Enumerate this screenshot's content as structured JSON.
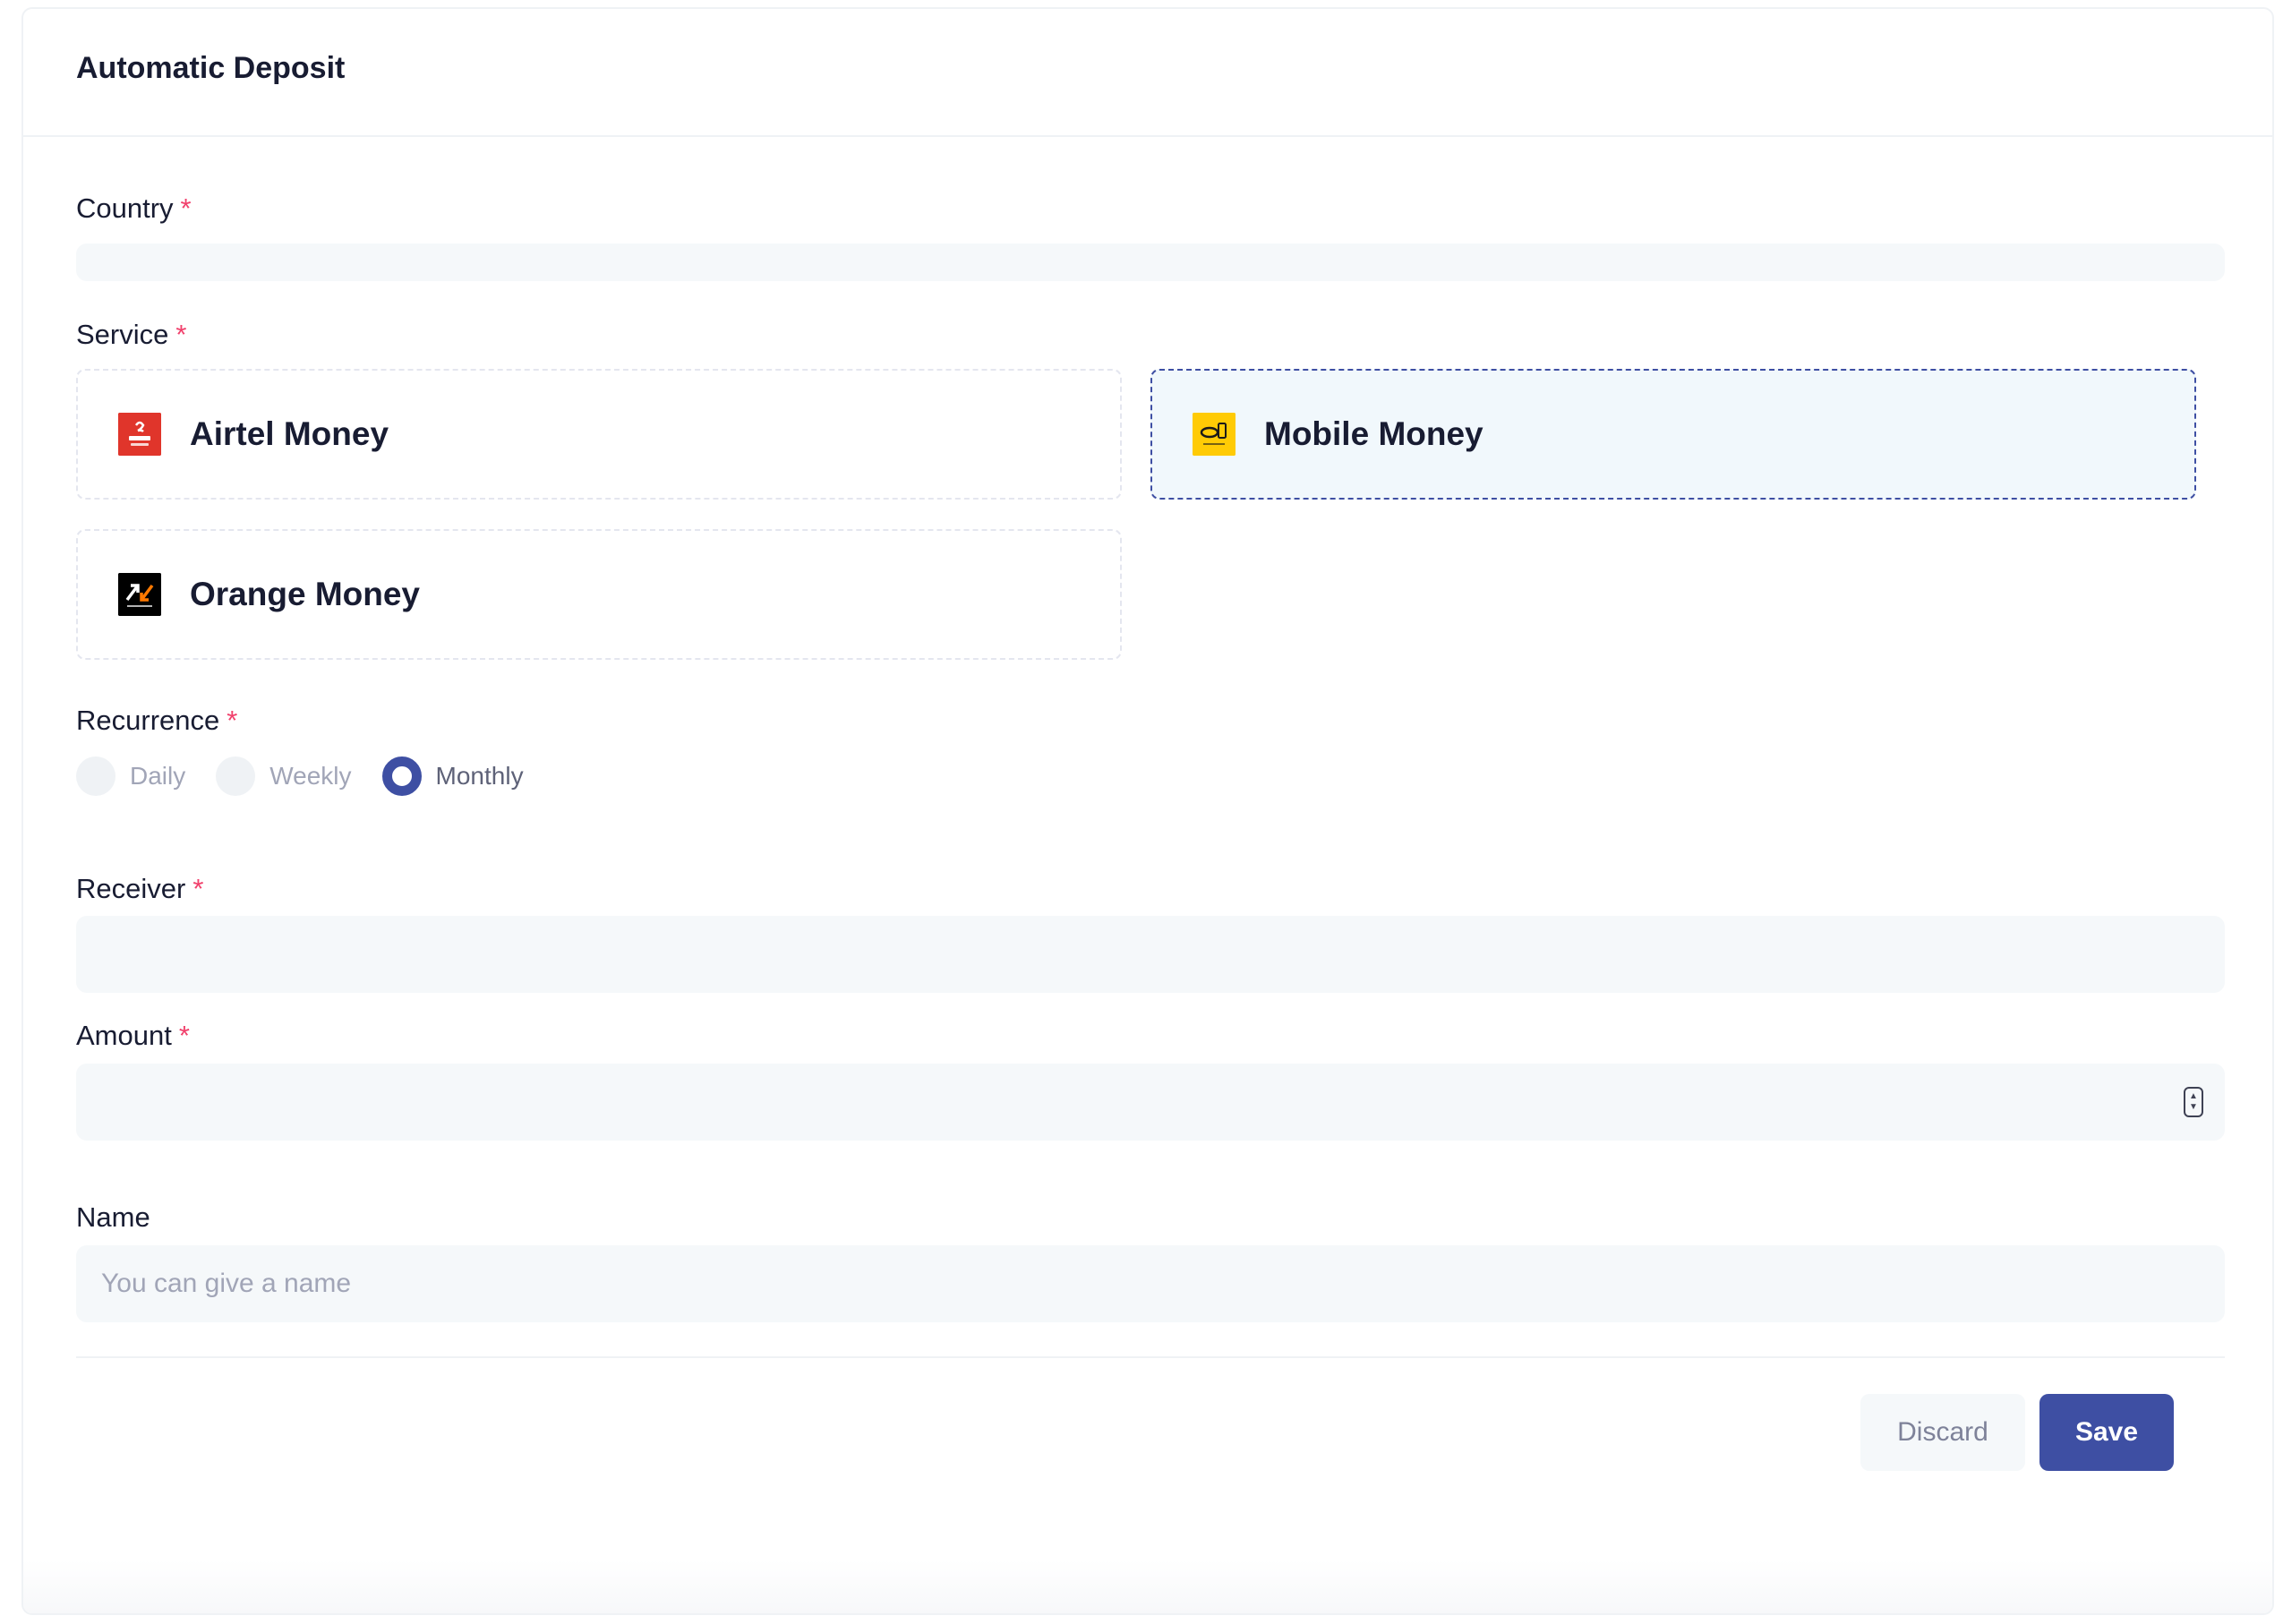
{
  "header": {
    "title": "Automatic Deposit"
  },
  "form": {
    "required_mark": "*",
    "country": {
      "label": "Country",
      "value": ""
    },
    "service": {
      "label": "Service",
      "options": [
        {
          "label": "Airtel Money",
          "logo": "airtel-logo",
          "logo_color": "#e0352b",
          "selected": false
        },
        {
          "label": "Mobile Money",
          "logo": "mtn-momo-logo",
          "logo_color": "#ffcb05",
          "selected": true
        },
        {
          "label": "Orange Money",
          "logo": "orange-money-logo",
          "logo_color": "#000000",
          "selected": false
        }
      ]
    },
    "recurrence": {
      "label": "Recurrence",
      "options": [
        "Daily",
        "Weekly",
        "Monthly"
      ],
      "selected": "Monthly"
    },
    "receiver": {
      "label": "Receiver",
      "value": ""
    },
    "amount": {
      "label": "Amount",
      "value": ""
    },
    "name": {
      "label": "Name",
      "value": "",
      "placeholder": "You can give a name"
    }
  },
  "actions": {
    "discard_label": "Discard",
    "save_label": "Save"
  },
  "colors": {
    "accent": "#3e4fa3",
    "required": "#f1416c",
    "input_bg": "#f5f8fa",
    "selected_bg": "#f1f8fc"
  }
}
